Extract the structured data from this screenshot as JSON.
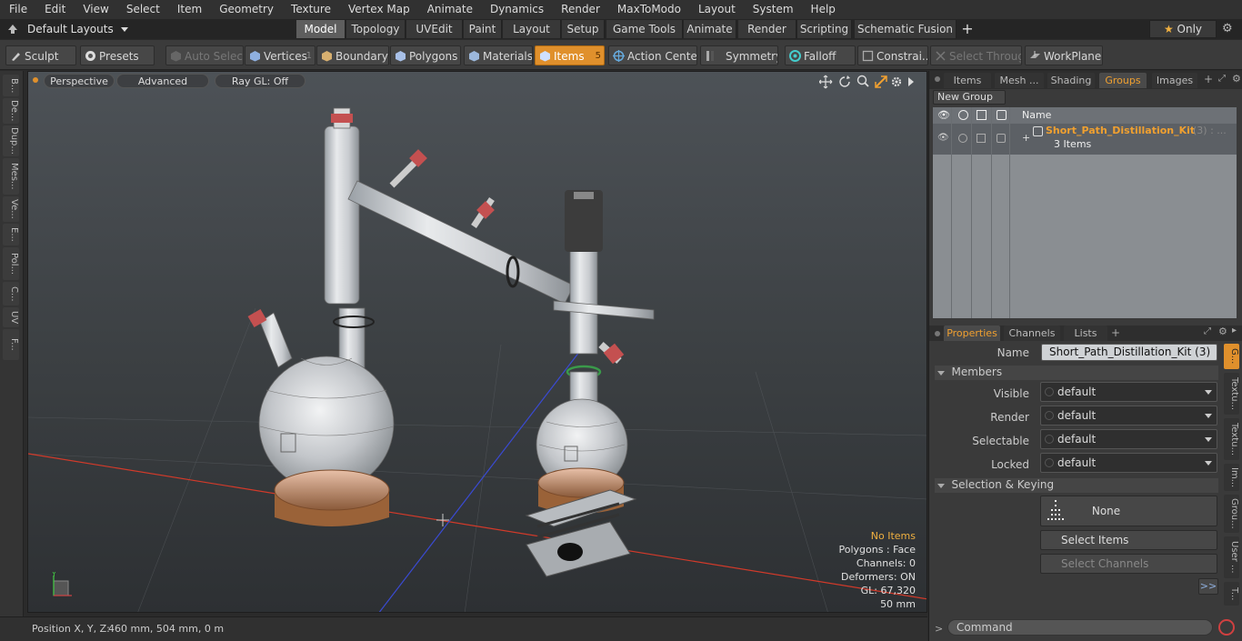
{
  "menu": [
    "File",
    "Edit",
    "View",
    "Select",
    "Item",
    "Geometry",
    "Texture",
    "Vertex Map",
    "Animate",
    "Dynamics",
    "Render",
    "MaxToModo",
    "Layout",
    "System",
    "Help"
  ],
  "layout_dropdown": "Default Layouts",
  "layout_tabs": [
    "Model",
    "Topology",
    "UVEdit",
    "Paint",
    "Layout",
    "Setup",
    "Game Tools",
    "Animate",
    "Render",
    "Scripting",
    "Schematic Fusion"
  ],
  "add_tab": "+",
  "only_label": "Only",
  "toolbar": {
    "sculpt": "Sculpt",
    "presets": "Presets",
    "auto_select": "Auto Select",
    "vertices": "Vertices",
    "vertices_count": "1",
    "boundary": "Boundary",
    "polygons": "Polygons",
    "materials": "Materials",
    "items": "Items",
    "items_count": "5",
    "action_center": "Action Center",
    "symmetry": "Symmetry",
    "falloff": "Falloff",
    "constraints": "Constrai...",
    "select_through": "Select Through",
    "workplane": "WorkPlane"
  },
  "left_tabs": [
    "B...",
    "De...",
    "Dup...",
    "Mes...",
    "Ve...",
    "E...",
    "Pol...",
    "C...",
    "UV",
    "F..."
  ],
  "viewport": {
    "perspective": "Perspective",
    "advanced": "Advanced",
    "raygl": "Ray GL: Off",
    "info": {
      "no_items": "No Items",
      "polygons": "Polygons : Face",
      "channels": "Channels: 0",
      "deformers": "Deformers: ON",
      "gl": "GL: 67,320",
      "scale": "50 mm"
    }
  },
  "status": {
    "label": "Position X, Y, Z:",
    "value": "460 mm, 504 mm, 0 m"
  },
  "groups_panel": {
    "tabs": [
      "Items",
      "Mesh ...",
      "Shading",
      "Groups",
      "Images"
    ],
    "active_tab": "Groups",
    "new_group": "New Group",
    "col_name": "Name",
    "group_name": "Short_Path_Distillation_Kit",
    "group_suffix": "(3) : ...",
    "group_items": "3 Items"
  },
  "properties_panel": {
    "tabs": [
      "Properties",
      "Channels",
      "Lists"
    ],
    "add_tab": "+",
    "name_label": "Name",
    "name_value": "Short_Path_Distillation_Kit (3)",
    "members_header": "Members",
    "visible_label": "Visible",
    "visible_value": "default",
    "render_label": "Render",
    "render_value": "default",
    "selectable_label": "Selectable",
    "selectable_value": "default",
    "locked_label": "Locked",
    "locked_value": "default",
    "selection_header": "Selection & Keying",
    "none_btn": "None",
    "select_items": "Select Items",
    "select_channels": "Select Channels",
    "more_btn": ">>",
    "side_tabs": [
      "G...",
      "Textu...",
      "Textu...",
      "Im...",
      "Grou...",
      "User ...",
      "T..."
    ]
  },
  "command": {
    "placeholder": "Command",
    "prompt": ">"
  },
  "colors": {
    "accent_orange": "#e0902c",
    "group_orange": "#f0a030",
    "x_axis": "#d23a2a",
    "z_axis": "#3a4ad2"
  }
}
